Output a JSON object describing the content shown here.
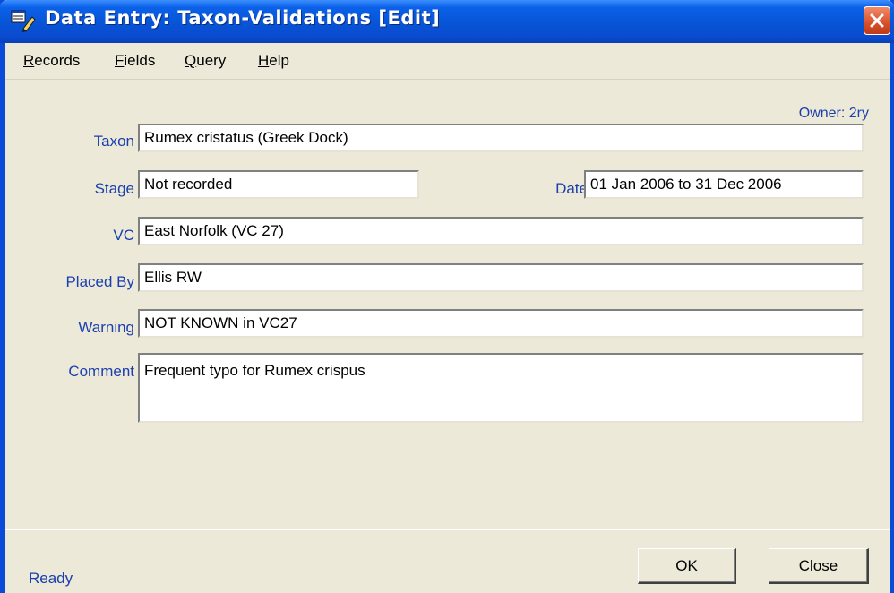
{
  "window": {
    "title": "Data Entry: Taxon-Validations [Edit]",
    "title_bar_color": "#0a4bd8",
    "close_button_color": "#d8502a"
  },
  "menu": {
    "items": [
      {
        "accel": "R",
        "rest": "ecords"
      },
      {
        "accel": "F",
        "rest": "ields"
      },
      {
        "accel": "Q",
        "rest": "uery"
      },
      {
        "accel": "H",
        "rest": "elp"
      }
    ]
  },
  "owner": "Owner: 2ry",
  "form": {
    "taxon": {
      "label": "Taxon",
      "value": "Rumex cristatus (Greek Dock)"
    },
    "stage": {
      "label": "Stage",
      "value": "Not recorded"
    },
    "date": {
      "label": "Date",
      "value": "01 Jan 2006 to 31 Dec 2006"
    },
    "vc": {
      "label": "VC",
      "value": "East Norfolk (VC 27)"
    },
    "placed_by": {
      "label": "Placed By",
      "value": "Ellis RW"
    },
    "warning": {
      "label": "Warning",
      "value": "NOT KNOWN in VC27"
    },
    "comment": {
      "label": "Comment",
      "value": "Frequent typo for Rumex crispus"
    }
  },
  "label_color": "#1a3fae",
  "status": "Ready",
  "buttons": {
    "ok": {
      "accel": "O",
      "rest": "K"
    },
    "close": {
      "accel": "C",
      "rest": "lose"
    }
  }
}
